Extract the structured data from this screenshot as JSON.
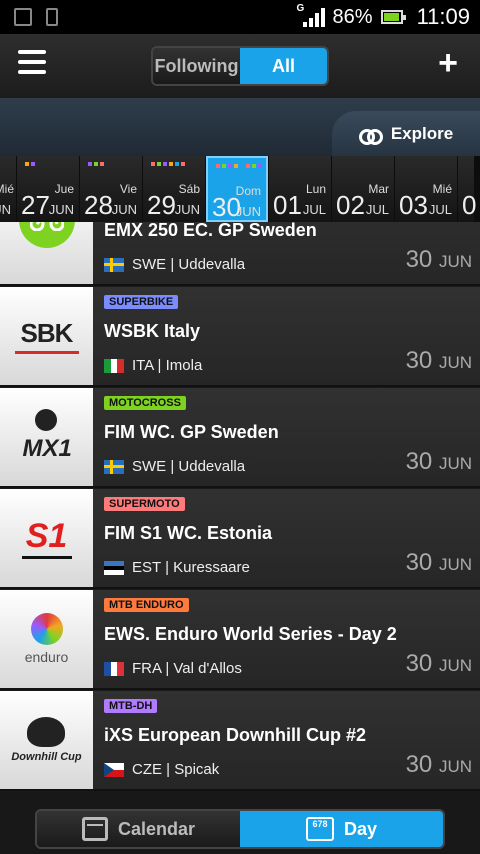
{
  "status_bar": {
    "network": "G",
    "battery": "86%",
    "time": "11:09"
  },
  "header": {
    "seg_following": "Following",
    "seg_all": "All",
    "add": "+"
  },
  "explore": {
    "label": "Explore"
  },
  "dates": [
    {
      "name": "Mié",
      "num": "",
      "mon": "JUN",
      "partial": "left",
      "dots": []
    },
    {
      "name": "Jue",
      "num": "27",
      "mon": "JUN",
      "dots": [
        "#f5a623",
        "#9b59ff"
      ]
    },
    {
      "name": "Vie",
      "num": "28",
      "mon": "JUN",
      "dots": [
        "#9b59ff",
        "#7ed321",
        "#ff6a6a"
      ]
    },
    {
      "name": "Sáb",
      "num": "29",
      "mon": "JUN",
      "dots": [
        "#ff6a6a",
        "#7ed321",
        "#9b59ff",
        "#f5a623",
        "#1aa3e8",
        "#ff6a6a"
      ]
    },
    {
      "name": "Dom",
      "num": "30",
      "mon": "JUN",
      "selected": true,
      "dots": [
        "#ff6a6a",
        "#7ed321",
        "#9b59ff",
        "#f5a623",
        "#1aa3e8",
        "#ff6a6a",
        "#7ed321",
        "#9b59ff"
      ]
    },
    {
      "name": "Lun",
      "num": "01",
      "mon": "JUL",
      "dots": []
    },
    {
      "name": "Mar",
      "num": "02",
      "mon": "JUL",
      "dots": []
    },
    {
      "name": "Mié",
      "num": "03",
      "mon": "JUL",
      "dots": []
    },
    {
      "name": "",
      "num": "0",
      "mon": "",
      "partial": "right",
      "dots": []
    }
  ],
  "events": [
    {
      "tag": "",
      "tag_color": "",
      "title": "EMX 250 EC. GP Sweden",
      "flag": "swe",
      "place": "SWE | Uddevalla",
      "day": "30",
      "mon": "JUN",
      "logo": "motocross-bike-icon"
    },
    {
      "tag": "SUPERBIKE",
      "tag_color": "#7b8cff",
      "title": "WSBK Italy",
      "flag": "ita",
      "place": "ITA | Imola",
      "day": "30",
      "mon": "JUN",
      "logo": "sbk-logo",
      "logo_text": "SBK"
    },
    {
      "tag": "MOTOCROSS",
      "tag_color": "#7ed321",
      "title": "FIM WC. GP Sweden",
      "flag": "swe",
      "place": "SWE | Uddevalla",
      "day": "30",
      "mon": "JUN",
      "logo": "mx1-logo",
      "logo_text": "MX1"
    },
    {
      "tag": "SUPERMOTO",
      "tag_color": "#ff7b7b",
      "title": "FIM S1 WC. Estonia",
      "flag": "est",
      "place": "EST | Kuressaare",
      "day": "30",
      "mon": "JUN",
      "logo": "s1-supermoto-logo",
      "logo_text": "S1"
    },
    {
      "tag": "MTB ENDURO",
      "tag_color": "#ff7a3d",
      "title": "EWS. Enduro World Series - Day 2",
      "flag": "fra",
      "place": "FRA | Val d'Allos",
      "day": "30",
      "mon": "JUN",
      "logo": "enduro-logo",
      "logo_text": "enduro"
    },
    {
      "tag": "MTB-DH",
      "tag_color": "#b07bff",
      "title": "iXS European Downhill Cup #2",
      "flag": "cze",
      "place": "CZE | Spicak",
      "day": "30",
      "mon": "JUN",
      "logo": "downhill-cup-logo",
      "logo_text": "Downhill Cup"
    }
  ],
  "bottom": {
    "calendar": "Calendar",
    "day": "Day",
    "day_icon_digits": "678"
  }
}
